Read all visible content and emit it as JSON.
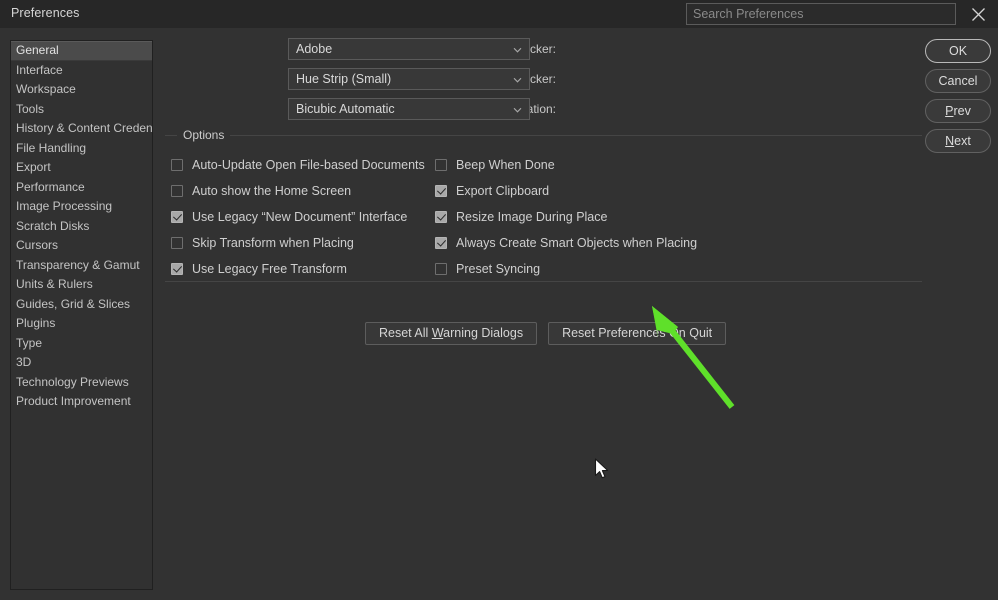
{
  "window": {
    "title": "Preferences",
    "close_icon": "close-icon"
  },
  "search": {
    "placeholder": "Search Preferences",
    "value": "",
    "icon": "search-icon"
  },
  "sidebar": {
    "selected": "General",
    "items": [
      {
        "label": "General"
      },
      {
        "label": "Interface"
      },
      {
        "label": "Workspace"
      },
      {
        "label": "Tools"
      },
      {
        "label": "History & Content Credentials"
      },
      {
        "label": "File Handling"
      },
      {
        "label": "Export"
      },
      {
        "label": "Performance"
      },
      {
        "label": "Image Processing"
      },
      {
        "label": "Scratch Disks"
      },
      {
        "label": "Cursors"
      },
      {
        "label": "Transparency & Gamut"
      },
      {
        "label": "Units & Rulers"
      },
      {
        "label": "Guides, Grid & Slices"
      },
      {
        "label": "Plugins"
      },
      {
        "label": "Type"
      },
      {
        "label": "3D"
      },
      {
        "label": "Technology Previews"
      },
      {
        "label": "Product Improvement"
      }
    ]
  },
  "fields": [
    {
      "label": "Color Picker:",
      "value": "Adobe",
      "icon": "chevron-down-icon"
    },
    {
      "label": "HUD Color Picker:",
      "value": "Hue Strip (Small)",
      "icon": "chevron-down-icon"
    },
    {
      "label": "Image Interpolation:",
      "value": "Bicubic Automatic",
      "icon": "chevron-down-icon"
    }
  ],
  "options": {
    "legend": "Options",
    "left_column": [
      {
        "label": "Auto-Update Open File-based Documents",
        "checked": false
      },
      {
        "label": "Auto show the Home Screen",
        "checked": false
      },
      {
        "label": "Use Legacy “New Document” Interface",
        "checked": true
      },
      {
        "label": "Skip Transform when Placing",
        "checked": false
      },
      {
        "label": "Use Legacy Free Transform",
        "checked": true
      }
    ],
    "right_column": [
      {
        "label": "Beep When Done",
        "checked": false
      },
      {
        "label": "Export Clipboard",
        "checked": true
      },
      {
        "label": "Resize Image During Place",
        "checked": true
      },
      {
        "label": "Always Create Smart Objects when Placing",
        "checked": true
      },
      {
        "label": "Preset Syncing",
        "checked": false
      }
    ]
  },
  "reset_buttons": [
    {
      "label": "Reset All Warning Dialogs"
    },
    {
      "label": "Reset Preferences On Quit"
    }
  ],
  "action_buttons": [
    {
      "label": "OK",
      "primary": true
    },
    {
      "label": "Cancel",
      "primary": false
    },
    {
      "label": "Prev",
      "primary": false
    },
    {
      "label": "Next",
      "primary": false
    }
  ],
  "annotation": {
    "arrow_color": "#5FE02A",
    "points_to": "Reset Preferences On Quit"
  },
  "colors": {
    "dialog_background": "#323232",
    "titlebar_background": "#272727",
    "sidebar_background": "#313131",
    "selection": "#4b4b4b",
    "text": "#c8c8c8",
    "border": "#5a5a5a",
    "annotation_green": "#5FE02A"
  }
}
